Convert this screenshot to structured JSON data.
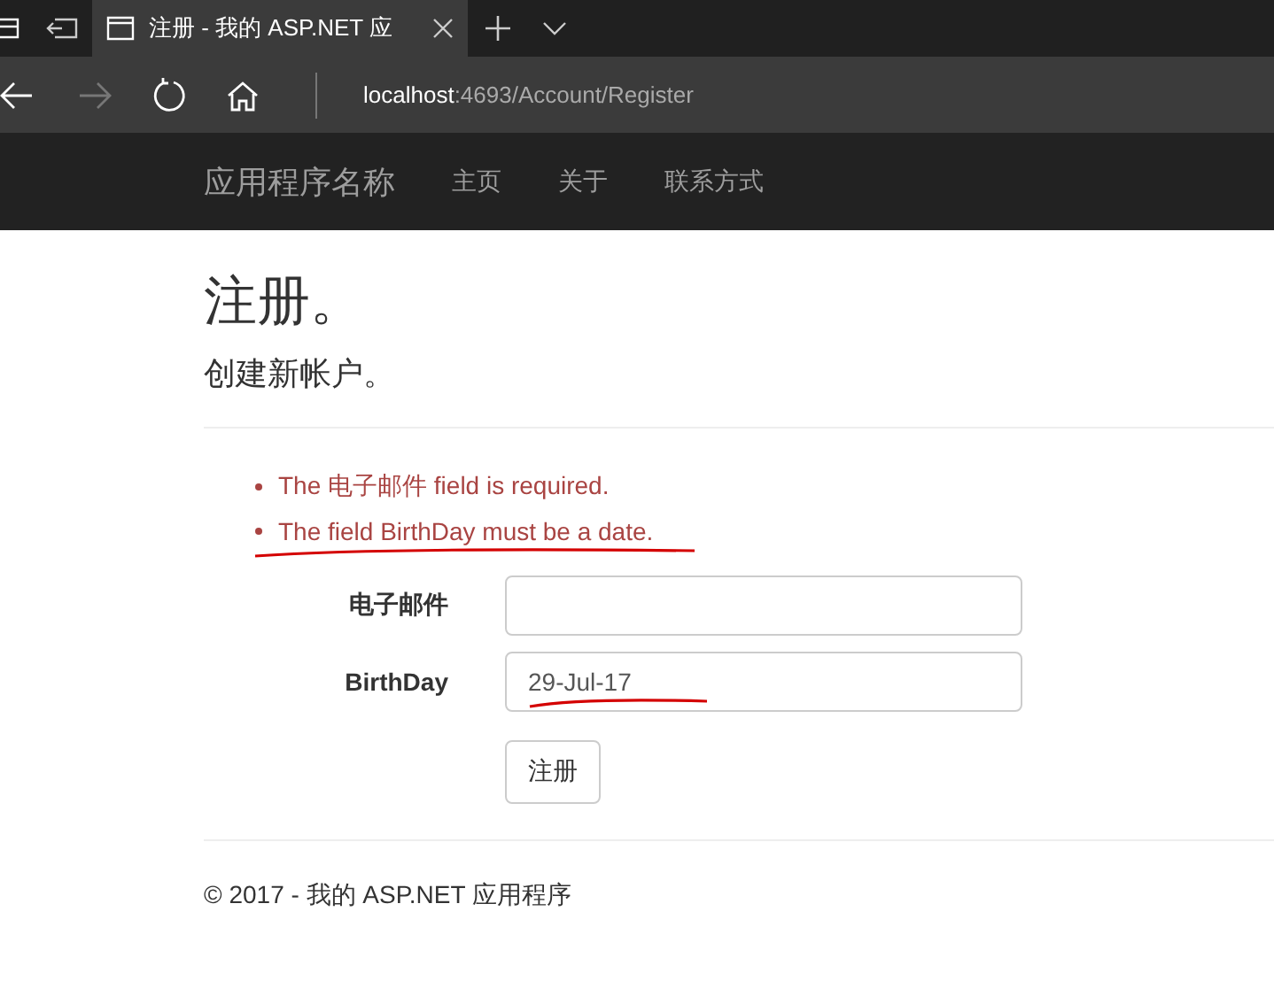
{
  "browser": {
    "tab": {
      "title": "注册 - 我的 ASP.NET 应",
      "selected": true
    },
    "address": {
      "host": "localhost",
      "path": ":4693/Account/Register"
    }
  },
  "navbar": {
    "brand": "应用程序名称",
    "links": [
      "主页",
      "关于",
      "联系方式"
    ]
  },
  "page": {
    "title": "注册。",
    "subtitle": "创建新帐户。"
  },
  "errors": [
    {
      "text": "The 电子邮件 field is required.",
      "marked": false
    },
    {
      "text": "The field BirthDay must be a date.",
      "marked": true
    }
  ],
  "form": {
    "fields": [
      {
        "label": "电子邮件",
        "marked": false
      },
      {
        "label": "BirthDay",
        "value": "29-Jul-17",
        "marked": true
      }
    ],
    "submit": "注册"
  },
  "footer": "© 2017 - 我的 ASP.NET 应用程序"
}
